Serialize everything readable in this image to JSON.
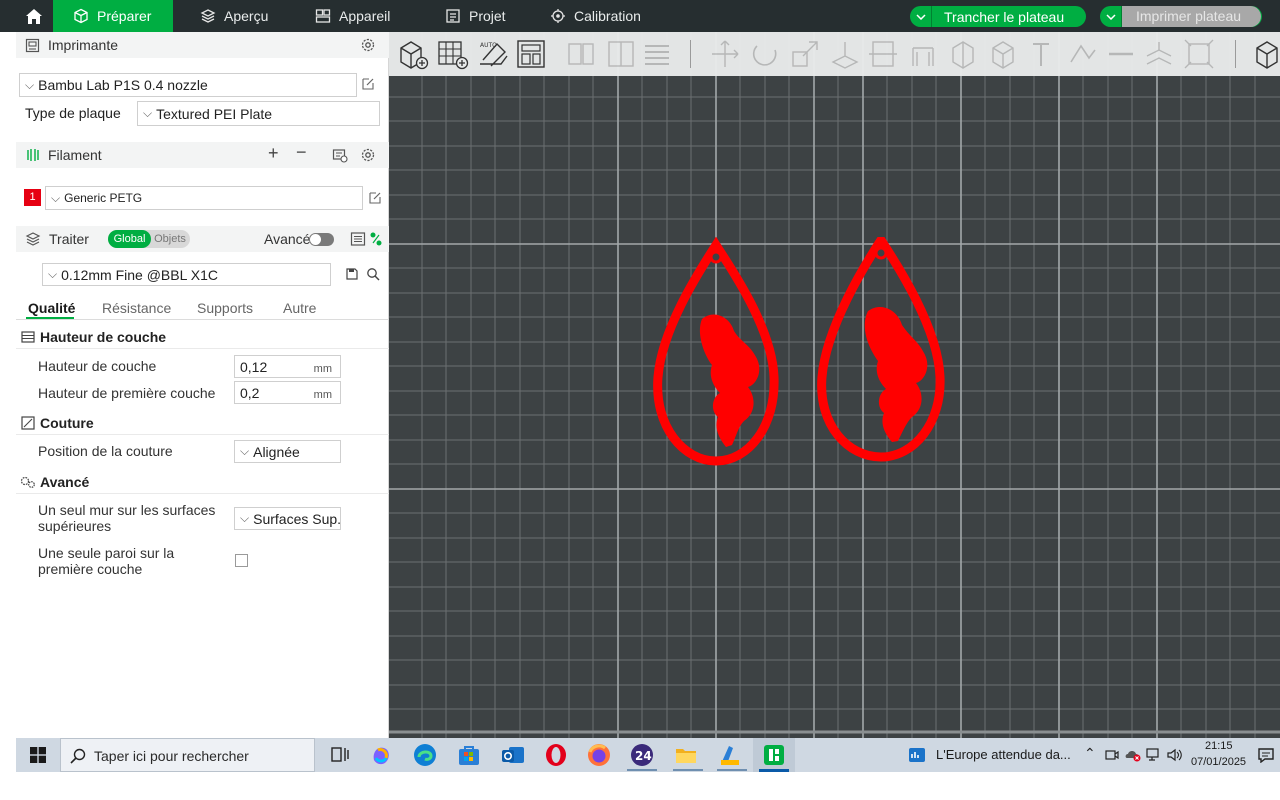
{
  "topbar": {
    "tabs": [
      {
        "label": "Préparer",
        "icon": "cube-icon",
        "active": true
      },
      {
        "label": "Aperçu",
        "icon": "layers-icon",
        "active": false
      },
      {
        "label": "Appareil",
        "icon": "device-icon",
        "active": false
      },
      {
        "label": "Projet",
        "icon": "project-icon",
        "active": false
      },
      {
        "label": "Calibration",
        "icon": "calibration-icon",
        "active": false
      }
    ],
    "slice_button": "Trancher le plateau",
    "print_button": "Imprimer plateau",
    "accent": "#00ae42"
  },
  "printer": {
    "section_title": "Imprimante",
    "printer_preset": "Bambu Lab P1S 0.4 nozzle",
    "plate_label": "Type de plaque",
    "plate_value": "Textured PEI Plate"
  },
  "filament": {
    "section_title": "Filament",
    "slot_number": "1",
    "slot_color": "#e60012",
    "preset": "Generic PETG"
  },
  "process": {
    "section_title": "Traiter",
    "toggle_global": "Global",
    "toggle_objects": "Objets",
    "advanced_label": "Avancé",
    "preset": "0.12mm Fine @BBL X1C",
    "tabs": [
      "Qualité",
      "Résistance",
      "Supports",
      "Autre"
    ],
    "active_tab": "Qualité"
  },
  "settings": {
    "layer_group": "Hauteur de couche",
    "layer_height_label": "Hauteur de couche",
    "layer_height_value": "0,12",
    "first_layer_label": "Hauteur de première couche",
    "first_layer_value": "0,2",
    "unit": "mm",
    "seam_group": "Couture",
    "seam_position_label": "Position de la couture",
    "seam_position_value": "Alignée",
    "advanced_group": "Avancé",
    "single_wall_top_label_1": "Un seul mur sur les surfaces",
    "single_wall_top_label_2": "supérieures",
    "single_wall_top_value": "Surfaces Sup.",
    "single_wall_first_label_1": "Une seule paroi sur la",
    "single_wall_first_label_2": "première couche",
    "single_wall_first_checked": false
  },
  "viewport": {
    "background": "#3d4244",
    "model_color": "#ff0000",
    "objects": [
      "earring-left",
      "earring-right"
    ]
  },
  "taskbar": {
    "search_placeholder": "Taper ici pour rechercher",
    "news_text": "L'Europe attendue da...",
    "time": "21:15",
    "date": "07/01/2025",
    "apps": [
      "task-view-icon",
      "copilot-icon",
      "edge-icon",
      "store-icon",
      "outlook-icon",
      "opera-icon",
      "firefox-icon",
      "app-24-icon",
      "file-explorer-icon",
      "paint-icon",
      "bambu-studio-icon"
    ]
  }
}
